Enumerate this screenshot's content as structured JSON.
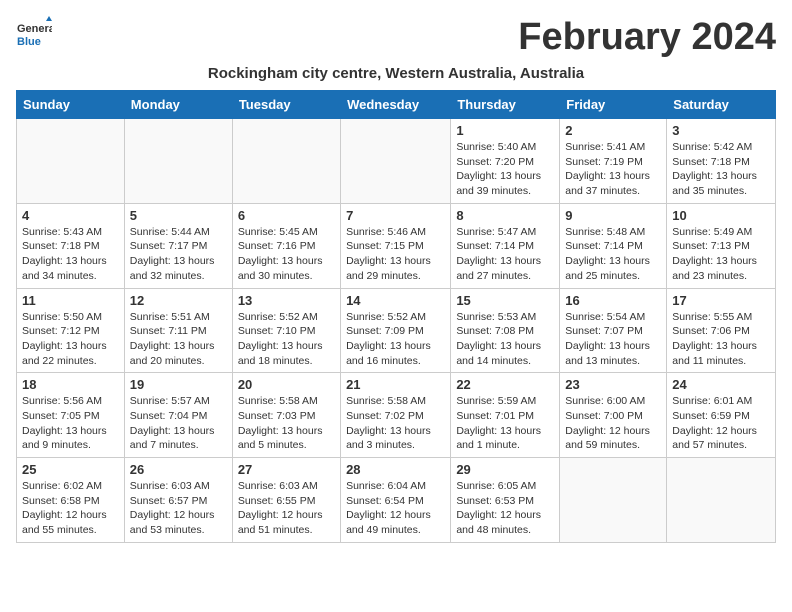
{
  "header": {
    "logo_line1": "General",
    "logo_line2": "Blue",
    "month_title": "February 2024",
    "subtitle": "Rockingham city centre, Western Australia, Australia"
  },
  "days_of_week": [
    "Sunday",
    "Monday",
    "Tuesday",
    "Wednesday",
    "Thursday",
    "Friday",
    "Saturday"
  ],
  "weeks": [
    [
      {
        "day": "",
        "detail": ""
      },
      {
        "day": "",
        "detail": ""
      },
      {
        "day": "",
        "detail": ""
      },
      {
        "day": "",
        "detail": ""
      },
      {
        "day": "1",
        "detail": "Sunrise: 5:40 AM\nSunset: 7:20 PM\nDaylight: 13 hours\nand 39 minutes."
      },
      {
        "day": "2",
        "detail": "Sunrise: 5:41 AM\nSunset: 7:19 PM\nDaylight: 13 hours\nand 37 minutes."
      },
      {
        "day": "3",
        "detail": "Sunrise: 5:42 AM\nSunset: 7:18 PM\nDaylight: 13 hours\nand 35 minutes."
      }
    ],
    [
      {
        "day": "4",
        "detail": "Sunrise: 5:43 AM\nSunset: 7:18 PM\nDaylight: 13 hours\nand 34 minutes."
      },
      {
        "day": "5",
        "detail": "Sunrise: 5:44 AM\nSunset: 7:17 PM\nDaylight: 13 hours\nand 32 minutes."
      },
      {
        "day": "6",
        "detail": "Sunrise: 5:45 AM\nSunset: 7:16 PM\nDaylight: 13 hours\nand 30 minutes."
      },
      {
        "day": "7",
        "detail": "Sunrise: 5:46 AM\nSunset: 7:15 PM\nDaylight: 13 hours\nand 29 minutes."
      },
      {
        "day": "8",
        "detail": "Sunrise: 5:47 AM\nSunset: 7:14 PM\nDaylight: 13 hours\nand 27 minutes."
      },
      {
        "day": "9",
        "detail": "Sunrise: 5:48 AM\nSunset: 7:14 PM\nDaylight: 13 hours\nand 25 minutes."
      },
      {
        "day": "10",
        "detail": "Sunrise: 5:49 AM\nSunset: 7:13 PM\nDaylight: 13 hours\nand 23 minutes."
      }
    ],
    [
      {
        "day": "11",
        "detail": "Sunrise: 5:50 AM\nSunset: 7:12 PM\nDaylight: 13 hours\nand 22 minutes."
      },
      {
        "day": "12",
        "detail": "Sunrise: 5:51 AM\nSunset: 7:11 PM\nDaylight: 13 hours\nand 20 minutes."
      },
      {
        "day": "13",
        "detail": "Sunrise: 5:52 AM\nSunset: 7:10 PM\nDaylight: 13 hours\nand 18 minutes."
      },
      {
        "day": "14",
        "detail": "Sunrise: 5:52 AM\nSunset: 7:09 PM\nDaylight: 13 hours\nand 16 minutes."
      },
      {
        "day": "15",
        "detail": "Sunrise: 5:53 AM\nSunset: 7:08 PM\nDaylight: 13 hours\nand 14 minutes."
      },
      {
        "day": "16",
        "detail": "Sunrise: 5:54 AM\nSunset: 7:07 PM\nDaylight: 13 hours\nand 13 minutes."
      },
      {
        "day": "17",
        "detail": "Sunrise: 5:55 AM\nSunset: 7:06 PM\nDaylight: 13 hours\nand 11 minutes."
      }
    ],
    [
      {
        "day": "18",
        "detail": "Sunrise: 5:56 AM\nSunset: 7:05 PM\nDaylight: 13 hours\nand 9 minutes."
      },
      {
        "day": "19",
        "detail": "Sunrise: 5:57 AM\nSunset: 7:04 PM\nDaylight: 13 hours\nand 7 minutes."
      },
      {
        "day": "20",
        "detail": "Sunrise: 5:58 AM\nSunset: 7:03 PM\nDaylight: 13 hours\nand 5 minutes."
      },
      {
        "day": "21",
        "detail": "Sunrise: 5:58 AM\nSunset: 7:02 PM\nDaylight: 13 hours\nand 3 minutes."
      },
      {
        "day": "22",
        "detail": "Sunrise: 5:59 AM\nSunset: 7:01 PM\nDaylight: 13 hours\nand 1 minute."
      },
      {
        "day": "23",
        "detail": "Sunrise: 6:00 AM\nSunset: 7:00 PM\nDaylight: 12 hours\nand 59 minutes."
      },
      {
        "day": "24",
        "detail": "Sunrise: 6:01 AM\nSunset: 6:59 PM\nDaylight: 12 hours\nand 57 minutes."
      }
    ],
    [
      {
        "day": "25",
        "detail": "Sunrise: 6:02 AM\nSunset: 6:58 PM\nDaylight: 12 hours\nand 55 minutes."
      },
      {
        "day": "26",
        "detail": "Sunrise: 6:03 AM\nSunset: 6:57 PM\nDaylight: 12 hours\nand 53 minutes."
      },
      {
        "day": "27",
        "detail": "Sunrise: 6:03 AM\nSunset: 6:55 PM\nDaylight: 12 hours\nand 51 minutes."
      },
      {
        "day": "28",
        "detail": "Sunrise: 6:04 AM\nSunset: 6:54 PM\nDaylight: 12 hours\nand 49 minutes."
      },
      {
        "day": "29",
        "detail": "Sunrise: 6:05 AM\nSunset: 6:53 PM\nDaylight: 12 hours\nand 48 minutes."
      },
      {
        "day": "",
        "detail": ""
      },
      {
        "day": "",
        "detail": ""
      }
    ]
  ]
}
